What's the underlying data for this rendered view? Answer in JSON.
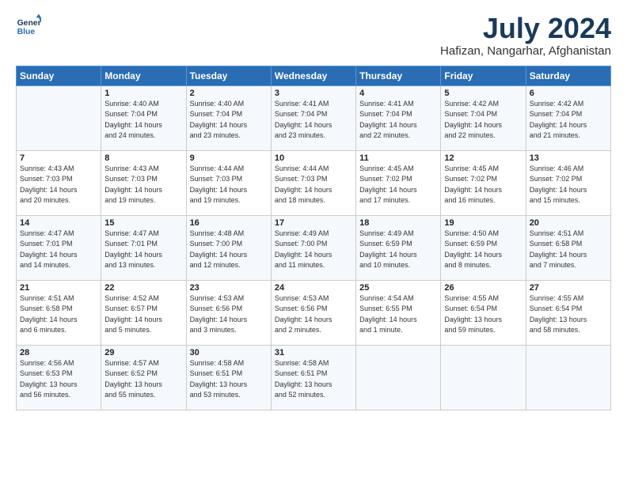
{
  "header": {
    "logo_line1": "General",
    "logo_line2": "Blue",
    "title": "July 2024",
    "location": "Hafizan, Nangarhar, Afghanistan"
  },
  "weekdays": [
    "Sunday",
    "Monday",
    "Tuesday",
    "Wednesday",
    "Thursday",
    "Friday",
    "Saturday"
  ],
  "weeks": [
    [
      {
        "day": "",
        "info": ""
      },
      {
        "day": "1",
        "info": "Sunrise: 4:40 AM\nSunset: 7:04 PM\nDaylight: 14 hours\nand 24 minutes."
      },
      {
        "day": "2",
        "info": "Sunrise: 4:40 AM\nSunset: 7:04 PM\nDaylight: 14 hours\nand 23 minutes."
      },
      {
        "day": "3",
        "info": "Sunrise: 4:41 AM\nSunset: 7:04 PM\nDaylight: 14 hours\nand 23 minutes."
      },
      {
        "day": "4",
        "info": "Sunrise: 4:41 AM\nSunset: 7:04 PM\nDaylight: 14 hours\nand 22 minutes."
      },
      {
        "day": "5",
        "info": "Sunrise: 4:42 AM\nSunset: 7:04 PM\nDaylight: 14 hours\nand 22 minutes."
      },
      {
        "day": "6",
        "info": "Sunrise: 4:42 AM\nSunset: 7:04 PM\nDaylight: 14 hours\nand 21 minutes."
      }
    ],
    [
      {
        "day": "7",
        "info": "Sunrise: 4:43 AM\nSunset: 7:03 PM\nDaylight: 14 hours\nand 20 minutes."
      },
      {
        "day": "8",
        "info": "Sunrise: 4:43 AM\nSunset: 7:03 PM\nDaylight: 14 hours\nand 19 minutes."
      },
      {
        "day": "9",
        "info": "Sunrise: 4:44 AM\nSunset: 7:03 PM\nDaylight: 14 hours\nand 19 minutes."
      },
      {
        "day": "10",
        "info": "Sunrise: 4:44 AM\nSunset: 7:03 PM\nDaylight: 14 hours\nand 18 minutes."
      },
      {
        "day": "11",
        "info": "Sunrise: 4:45 AM\nSunset: 7:02 PM\nDaylight: 14 hours\nand 17 minutes."
      },
      {
        "day": "12",
        "info": "Sunrise: 4:45 AM\nSunset: 7:02 PM\nDaylight: 14 hours\nand 16 minutes."
      },
      {
        "day": "13",
        "info": "Sunrise: 4:46 AM\nSunset: 7:02 PM\nDaylight: 14 hours\nand 15 minutes."
      }
    ],
    [
      {
        "day": "14",
        "info": "Sunrise: 4:47 AM\nSunset: 7:01 PM\nDaylight: 14 hours\nand 14 minutes."
      },
      {
        "day": "15",
        "info": "Sunrise: 4:47 AM\nSunset: 7:01 PM\nDaylight: 14 hours\nand 13 minutes."
      },
      {
        "day": "16",
        "info": "Sunrise: 4:48 AM\nSunset: 7:00 PM\nDaylight: 14 hours\nand 12 minutes."
      },
      {
        "day": "17",
        "info": "Sunrise: 4:49 AM\nSunset: 7:00 PM\nDaylight: 14 hours\nand 11 minutes."
      },
      {
        "day": "18",
        "info": "Sunrise: 4:49 AM\nSunset: 6:59 PM\nDaylight: 14 hours\nand 10 minutes."
      },
      {
        "day": "19",
        "info": "Sunrise: 4:50 AM\nSunset: 6:59 PM\nDaylight: 14 hours\nand 8 minutes."
      },
      {
        "day": "20",
        "info": "Sunrise: 4:51 AM\nSunset: 6:58 PM\nDaylight: 14 hours\nand 7 minutes."
      }
    ],
    [
      {
        "day": "21",
        "info": "Sunrise: 4:51 AM\nSunset: 6:58 PM\nDaylight: 14 hours\nand 6 minutes."
      },
      {
        "day": "22",
        "info": "Sunrise: 4:52 AM\nSunset: 6:57 PM\nDaylight: 14 hours\nand 5 minutes."
      },
      {
        "day": "23",
        "info": "Sunrise: 4:53 AM\nSunset: 6:56 PM\nDaylight: 14 hours\nand 3 minutes."
      },
      {
        "day": "24",
        "info": "Sunrise: 4:53 AM\nSunset: 6:56 PM\nDaylight: 14 hours\nand 2 minutes."
      },
      {
        "day": "25",
        "info": "Sunrise: 4:54 AM\nSunset: 6:55 PM\nDaylight: 14 hours\nand 1 minute."
      },
      {
        "day": "26",
        "info": "Sunrise: 4:55 AM\nSunset: 6:54 PM\nDaylight: 13 hours\nand 59 minutes."
      },
      {
        "day": "27",
        "info": "Sunrise: 4:55 AM\nSunset: 6:54 PM\nDaylight: 13 hours\nand 58 minutes."
      }
    ],
    [
      {
        "day": "28",
        "info": "Sunrise: 4:56 AM\nSunset: 6:53 PM\nDaylight: 13 hours\nand 56 minutes."
      },
      {
        "day": "29",
        "info": "Sunrise: 4:57 AM\nSunset: 6:52 PM\nDaylight: 13 hours\nand 55 minutes."
      },
      {
        "day": "30",
        "info": "Sunrise: 4:58 AM\nSunset: 6:51 PM\nDaylight: 13 hours\nand 53 minutes."
      },
      {
        "day": "31",
        "info": "Sunrise: 4:58 AM\nSunset: 6:51 PM\nDaylight: 13 hours\nand 52 minutes."
      },
      {
        "day": "",
        "info": ""
      },
      {
        "day": "",
        "info": ""
      },
      {
        "day": "",
        "info": ""
      }
    ]
  ]
}
